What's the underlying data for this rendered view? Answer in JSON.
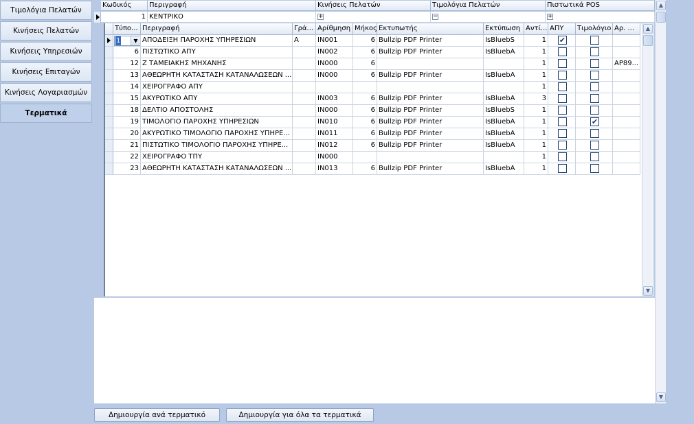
{
  "nav": {
    "items": [
      {
        "label": "Τιμολόγια Πελατών"
      },
      {
        "label": "Κινήσεις Πελατών"
      },
      {
        "label": "Κινήσεις Υπηρεσιών"
      },
      {
        "label": "Κινήσεις Επιταγών"
      },
      {
        "label": "Κινήσεις Λογαριασμών"
      },
      {
        "label": "Τερματικά"
      }
    ],
    "active_index": 5
  },
  "master": {
    "columns": [
      "Κωδικός",
      "Περιγραφή",
      "Κινήσεις Πελατών",
      "Τιμολόγια Πελατών",
      "Πιστωτικά POS"
    ],
    "row": {
      "code": "1",
      "description": "ΚΕΝΤΡΙΚΟ",
      "expanders": [
        "+",
        "−",
        "+"
      ]
    }
  },
  "detail": {
    "columns": [
      "Τύπο...",
      "Περιγραφή",
      "Γρά...",
      "Αρίθμηση",
      "Μήκος",
      "Εκτυπωτής",
      "Εκτύπωση",
      "Αντί...",
      "ΑΠΥ",
      "Τιμολόγιο",
      "Αρ. ..."
    ],
    "rows": [
      {
        "type": "1",
        "description": "ΑΠΟΔΕΙΞΗ ΠΑΡΟΧΗΣ ΥΠΗΡΕΣΙΩΝ",
        "letter": "A",
        "numbering": "IN001",
        "length": "6",
        "printer": "Bullzip PDF Printer",
        "print": "IsBluebS",
        "copies": "1",
        "apy": true,
        "invoice": false,
        "ar": ""
      },
      {
        "type": "6",
        "description": "ΠΙΣΤΩΤΙΚΟ ΑΠΥ",
        "letter": "",
        "numbering": "IN002",
        "length": "6",
        "printer": "Bullzip PDF Printer",
        "print": "IsBluebA",
        "copies": "1",
        "apy": false,
        "invoice": false,
        "ar": ""
      },
      {
        "type": "12",
        "description": "Ζ ΤΑΜΕΙΑΚΗΣ ΜΗΧΑΝΗΣ",
        "letter": "",
        "numbering": "IN000",
        "length": "6",
        "printer": "",
        "print": "",
        "copies": "1",
        "apy": false,
        "invoice": false,
        "ar": "AP89..."
      },
      {
        "type": "13",
        "description": "ΑΘΕΩΡΗΤΗ ΚΑΤΑΣΤΑΣΗ ΚΑΤΑΝΑΛΩΣΕΩΝ ...",
        "letter": "",
        "numbering": "IN000",
        "length": "6",
        "printer": "Bullzip PDF Printer",
        "print": "IsBluebA",
        "copies": "1",
        "apy": false,
        "invoice": false,
        "ar": ""
      },
      {
        "type": "14",
        "description": "ΧΕΙΡΟΓΡΑΦΟ ΑΠΥ",
        "letter": "",
        "numbering": "",
        "length": "",
        "printer": "",
        "print": "",
        "copies": "1",
        "apy": false,
        "invoice": false,
        "ar": ""
      },
      {
        "type": "15",
        "description": "ΑΚΥΡΩΤΙΚΟ ΑΠΥ",
        "letter": "",
        "numbering": "IN003",
        "length": "6",
        "printer": "Bullzip PDF Printer",
        "print": "IsBluebA",
        "copies": "3",
        "apy": false,
        "invoice": false,
        "ar": ""
      },
      {
        "type": "18",
        "description": "ΔΕΛΤΙΟ ΑΠΟΣΤΟΛΗΣ",
        "letter": "",
        "numbering": "IN000",
        "length": "6",
        "printer": "Bullzip PDF Printer",
        "print": "IsBluebS",
        "copies": "1",
        "apy": false,
        "invoice": false,
        "ar": ""
      },
      {
        "type": "19",
        "description": "ΤΙΜΟΛΟΓΙΟ ΠΑΡΟΧΗΣ ΥΠΗΡΕΣΙΩΝ",
        "letter": "",
        "numbering": "IN010",
        "length": "6",
        "printer": "Bullzip PDF Printer",
        "print": "IsBluebA",
        "copies": "1",
        "apy": false,
        "invoice": true,
        "ar": ""
      },
      {
        "type": "20",
        "description": "ΑΚΥΡΩΤΙΚΟ ΤΙΜΟΛΟΓΙΟ ΠΑΡΟΧΗΣ ΥΠΗΡΕ...",
        "letter": "",
        "numbering": "IN011",
        "length": "6",
        "printer": "Bullzip PDF Printer",
        "print": "IsBluebA",
        "copies": "1",
        "apy": false,
        "invoice": false,
        "ar": ""
      },
      {
        "type": "21",
        "description": "ΠΙΣΤΩΤΙΚΟ ΤΙΜΟΛΟΓΙΟ ΠΑΡΟΧΗΣ ΥΠΗΡΕ...",
        "letter": "",
        "numbering": "IN012",
        "length": "6",
        "printer": "Bullzip PDF Printer",
        "print": "IsBluebA",
        "copies": "1",
        "apy": false,
        "invoice": false,
        "ar": ""
      },
      {
        "type": "22",
        "description": "ΧΕΙΡΟΓΡΑΦΟ ΤΠΥ",
        "letter": "",
        "numbering": "IN000",
        "length": "",
        "printer": "",
        "print": "",
        "copies": "1",
        "apy": false,
        "invoice": false,
        "ar": ""
      },
      {
        "type": "23",
        "description": "ΑΘΕΩΡΗΤΗ ΚΑΤΑΣΤΑΣΗ ΚΑΤΑΝΑΛΩΣΕΩΝ ...",
        "letter": "",
        "numbering": "IN013",
        "length": "6",
        "printer": "Bullzip PDF Printer",
        "print": "IsBluebA",
        "copies": "1",
        "apy": false,
        "invoice": false,
        "ar": ""
      }
    ]
  },
  "buttons": {
    "create_per_terminal": "Δημιουργία ανά τερματικό",
    "create_all_terminals": "Δημιουργία για όλα τα τερματικά"
  },
  "icons": {
    "row_pointer": "row-pointer-icon",
    "dropdown": "chevron-down-icon",
    "scroll_up": "chevron-up-icon",
    "scroll_down": "chevron-down-icon",
    "check": "checkmark-icon"
  },
  "colors": {
    "background": "#b7c9e4",
    "selection": "#316ac5"
  }
}
